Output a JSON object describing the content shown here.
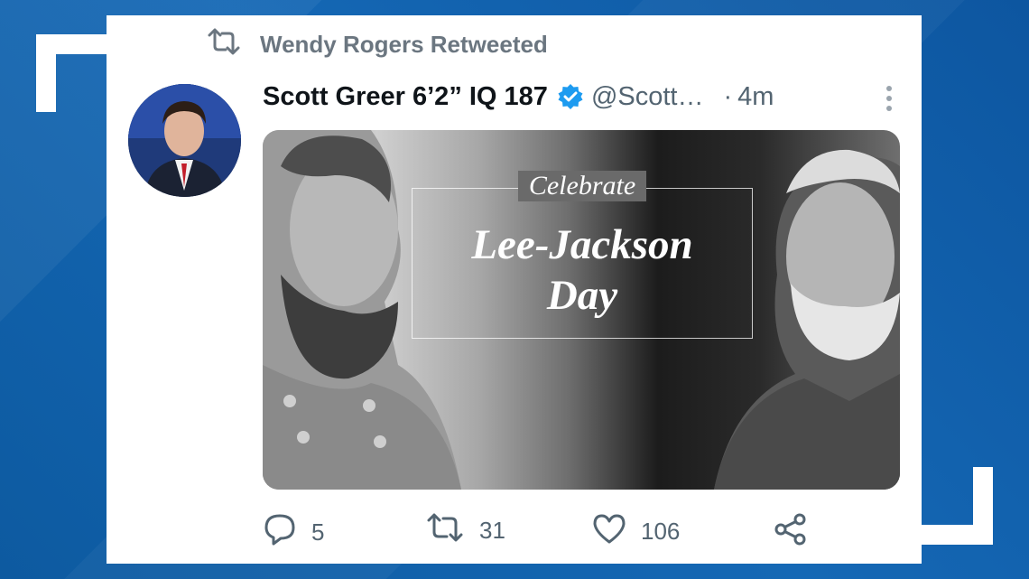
{
  "retweet": {
    "icon": "retweet-icon",
    "text": "Wendy Rogers Retweeted"
  },
  "tweet": {
    "author_name": "Scott Greer 6’2” IQ 187",
    "verified_icon": "verified-badge-icon",
    "handle": "@Scott…",
    "separator": "·",
    "time": "4m",
    "more_icon": "more-vertical-icon"
  },
  "media": {
    "promo_top": "Celebrate",
    "promo_line_1": "Lee-Jackson",
    "promo_line_2": "Day"
  },
  "actions": {
    "reply_count": "5",
    "retweet_count": "31",
    "like_count": "106",
    "share_icon": "share-icon"
  },
  "colors": {
    "background": "#0f5fa8",
    "card": "#ffffff",
    "text_primary": "#0f1419",
    "text_secondary": "#536471",
    "verified": "#1d9bf0"
  }
}
